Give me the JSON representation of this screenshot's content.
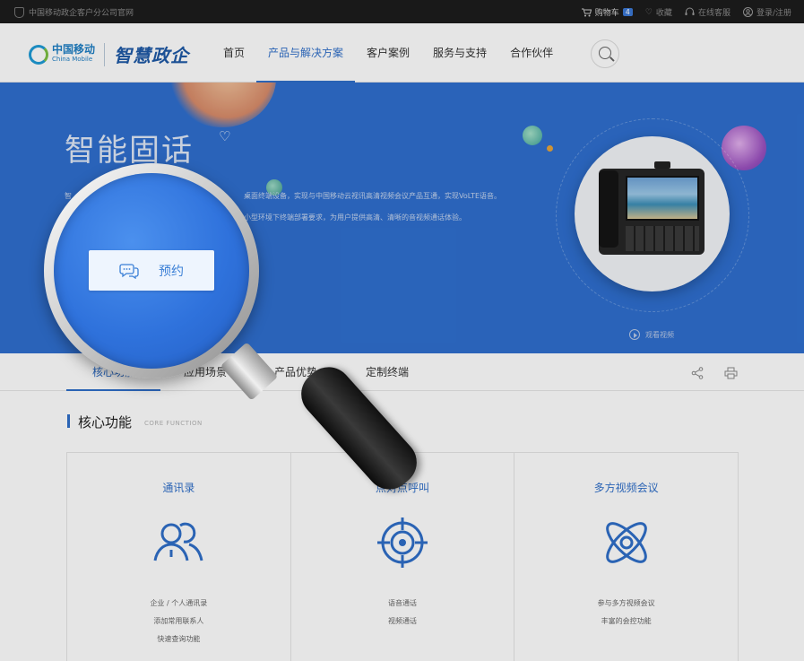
{
  "topbar": {
    "site_name": "中国移动政企客户分公司官网",
    "cart_label": "购物车",
    "cart_count": "4",
    "favorites_label": "收藏",
    "support_label": "在线客服",
    "login_label": "登录/注册"
  },
  "header": {
    "logo_cn": "中国移动",
    "logo_en": "China Mobile",
    "brand": "智慧政企",
    "nav": [
      "首页",
      "产品与解决方案",
      "客户案例",
      "服务与支持",
      "合作伙伴"
    ],
    "active_nav_index": 1
  },
  "banner": {
    "title": "智能固话",
    "desc_line1": "桌面终端设备，实现与中国移动云视讯高清视频会议产品互通，实现VoLTE语音。",
    "desc_line1_prefix": "智",
    "desc_line2": "小型环境下终端部署要求，为用户提供高清、清晰的音视频通话体验。",
    "reserve_label": "预约",
    "video_label": "观看视频"
  },
  "tabs": {
    "items": [
      "核心功能",
      "应用场景",
      "产品优势",
      "定制终端"
    ],
    "active_index": 0
  },
  "section": {
    "title": "核心功能",
    "subtitle": "CORE FUNCTION"
  },
  "cards": [
    {
      "title": "通讯录",
      "icon": "contacts-icon",
      "features": [
        "企业 / 个人通讯录",
        "添加常用联系人",
        "快速查询功能"
      ]
    },
    {
      "title": "点对点呼叫",
      "icon": "target-call-icon",
      "features": [
        "语音通话",
        "视频通话"
      ]
    },
    {
      "title": "多方视频会议",
      "icon": "atom-conference-icon",
      "features": [
        "参与多方视频会议",
        "丰富的会控功能"
      ]
    }
  ],
  "colors": {
    "accent": "#2f6fc9",
    "banner_bg": "#2f6fcf",
    "topbar_bg": "#1c1c1c"
  }
}
